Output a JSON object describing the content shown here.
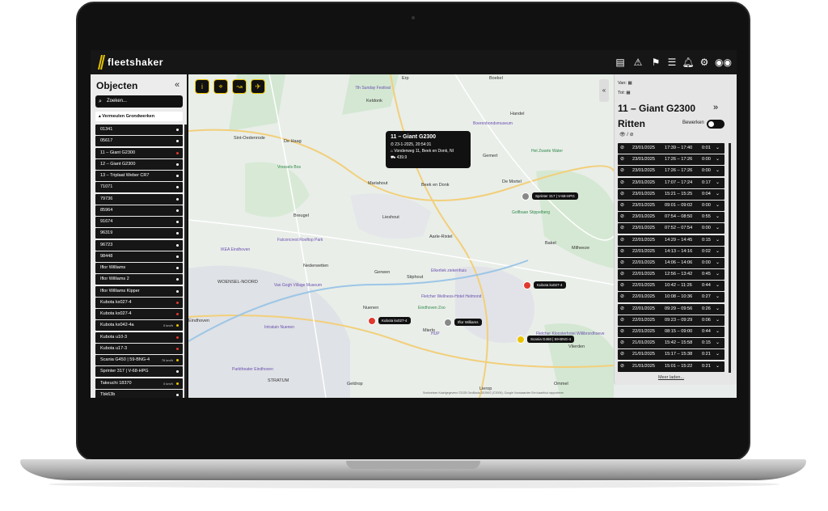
{
  "app": {
    "brand": "fleetshaker"
  },
  "topbar": {
    "icons": [
      "overview-icon",
      "alarm-icon",
      "route-icon",
      "report-icon",
      "bell-icon",
      "settings-icon",
      "vr-icon"
    ]
  },
  "objects_panel": {
    "title": "Objecten",
    "collapse": "«",
    "search_placeholder": "Zoeken...",
    "group": "Vermeulen Grondwerken",
    "items": [
      {
        "label": "01341",
        "dot": "#ffffff",
        "speed": ""
      },
      {
        "label": "05617",
        "dot": "#ffffff",
        "speed": ""
      },
      {
        "label": "11 – Giant G2300",
        "dot": "#e0392e",
        "speed": ""
      },
      {
        "label": "12 – Giant G2300",
        "dot": "#ffffff",
        "speed": ""
      },
      {
        "label": "13 – Triplaat Weber CR7",
        "dot": "#ffffff",
        "speed": ""
      },
      {
        "label": "71071",
        "dot": "#ffffff",
        "speed": ""
      },
      {
        "label": "79736",
        "dot": "#ffffff",
        "speed": ""
      },
      {
        "label": "85964",
        "dot": "#ffffff",
        "speed": ""
      },
      {
        "label": "91674",
        "dot": "#ffffff",
        "speed": ""
      },
      {
        "label": "96319",
        "dot": "#ffffff",
        "speed": ""
      },
      {
        "label": "96723",
        "dot": "#ffffff",
        "speed": ""
      },
      {
        "label": "98448",
        "dot": "#ffffff",
        "speed": ""
      },
      {
        "label": "Iflor Williams",
        "dot": "#ffffff",
        "speed": ""
      },
      {
        "label": "Iflor Williams 2",
        "dot": "#ffffff",
        "speed": ""
      },
      {
        "label": "Iflor Williams Kipper",
        "dot": "#ffffff",
        "speed": ""
      },
      {
        "label": "Kubota kx027-4",
        "dot": "#e0392e",
        "speed": ""
      },
      {
        "label": "Kubota kx027-4",
        "dot": "#e0392e",
        "speed": ""
      },
      {
        "label": "Kubota kx042-4a",
        "dot": "#e8c400",
        "speed": "0 km/h"
      },
      {
        "label": "Kubota u10-3",
        "dot": "#e0392e",
        "speed": ""
      },
      {
        "label": "Kubota u17-3",
        "dot": "#e0392e",
        "speed": ""
      },
      {
        "label": "Scania G450 | 59-BNG-4",
        "dot": "#e8c400",
        "speed": "76 km/h"
      },
      {
        "label": "Sprinter 317 | V-68-HPG",
        "dot": "#ffffff",
        "speed": ""
      },
      {
        "label": "Takeuchi 18370",
        "dot": "#e8c400",
        "speed": "0 km/h"
      },
      {
        "label": "Tbk63b",
        "dot": "#ffffff",
        "speed": ""
      }
    ]
  },
  "map": {
    "tools": [
      "i",
      "⌖",
      "↝",
      "✈"
    ],
    "places": [
      {
        "t": "Erp",
        "c": "label"
      },
      {
        "t": "Boekel",
        "c": "label"
      },
      {
        "t": "Keldonk",
        "c": "label"
      },
      {
        "t": "Sint-Oedenrode",
        "c": "label"
      },
      {
        "t": "De Haag",
        "c": "label"
      },
      {
        "t": "Handel",
        "c": "label"
      },
      {
        "t": "Gemert",
        "c": "label"
      },
      {
        "t": "Mariahout",
        "c": "label"
      },
      {
        "t": "Beek en Donk",
        "c": "label"
      },
      {
        "t": "De Mortel",
        "c": "label"
      },
      {
        "t": "Breugel",
        "c": "label"
      },
      {
        "t": "Lieshout",
        "c": "label"
      },
      {
        "t": "Aarle-Rixtel",
        "c": "label"
      },
      {
        "t": "Bakel",
        "c": "label"
      },
      {
        "t": "Milheeze",
        "c": "label"
      },
      {
        "t": "Nederwetten",
        "c": "label"
      },
      {
        "t": "Gerwen",
        "c": "label"
      },
      {
        "t": "Stiphout",
        "c": "label"
      },
      {
        "t": "WOENSEL-NOORD",
        "c": "label"
      },
      {
        "t": "Nuenen",
        "c": "label"
      },
      {
        "t": "Eindhoven",
        "c": "label"
      },
      {
        "t": "Mierlo",
        "c": "label"
      },
      {
        "t": "Vlierden",
        "c": "label"
      },
      {
        "t": "STRATUM",
        "c": "label"
      },
      {
        "t": "Geldrop",
        "c": "label"
      },
      {
        "t": "Lierop",
        "c": "label"
      },
      {
        "t": "Ommel",
        "c": "label"
      },
      {
        "t": "7th Sunday Festival",
        "c": "poi"
      },
      {
        "t": "Boerenbondsmuseum",
        "c": "poi"
      },
      {
        "t": "Het Zwarte Water",
        "c": "poi poi-g"
      },
      {
        "t": "Vressels Bos",
        "c": "poi poi-g"
      },
      {
        "t": "Golfbaan Stippelberg",
        "c": "poi poi-g"
      },
      {
        "t": "Falconcrest Rooftop Park",
        "c": "poi"
      },
      {
        "t": "IKEA Eindhoven",
        "c": "poi"
      },
      {
        "t": "Van Gogh Village Museum",
        "c": "poi"
      },
      {
        "t": "Elkerliek ziekenhuis",
        "c": "poi"
      },
      {
        "t": "Fletcher Wellness-Hotel Helmond",
        "c": "poi"
      },
      {
        "t": "Eindhoven Zoo",
        "c": "poi poi-g"
      },
      {
        "t": "HUP",
        "c": "poi"
      },
      {
        "t": "Fletcher Kloosterhotel Willibrordhoeve",
        "c": "poi"
      },
      {
        "t": "Parktheater Eindhoven",
        "c": "poi"
      },
      {
        "t": "Intratuin Nuenen",
        "c": "poi"
      }
    ],
    "vehicles": [
      {
        "label": "Kubota kx027-4",
        "color": "#e0392e"
      },
      {
        "label": "Kubota kx027-4",
        "color": "#e0392e"
      },
      {
        "label": "Iflor Williams",
        "color": "#888888"
      },
      {
        "label": "Scania G450 | 59-BNG-4",
        "color": "#e8c400"
      },
      {
        "label": "Sprinter 317 | V-68-HPG",
        "color": "#888888"
      }
    ],
    "popup": {
      "title": "11 – Giant G2300",
      "time": "23-1-2025, 20:54:31",
      "address": "Vonderweg 11, Beek en Donk, NI",
      "odo": "439.9"
    },
    "attribution": "Sneltoetsen   Kaartgegevens ©2025 GeoBasis-DE/BKG (©2009), Google   Voorwaarden   Een kaartfout rapporteren"
  },
  "rides_panel": {
    "van": "Van:",
    "tot": "Tot:",
    "vehicle": "11 – Giant G2300",
    "next": "»",
    "title": "Ritten",
    "bewerken": "Bewerken",
    "eye_filter": "👁 / ⊘",
    "more": "Meer laden...",
    "trips": [
      {
        "date": "23/01/2025",
        "time": "17:39 – 17:40",
        "dur": "0:01"
      },
      {
        "date": "23/01/2025",
        "time": "17:26 – 17:26",
        "dur": "0:00"
      },
      {
        "date": "23/01/2025",
        "time": "17:26 – 17:26",
        "dur": "0:00"
      },
      {
        "date": "23/01/2025",
        "time": "17:07 – 17:24",
        "dur": "0:17"
      },
      {
        "date": "23/01/2025",
        "time": "15:21 – 15:25",
        "dur": "0:04"
      },
      {
        "date": "23/01/2025",
        "time": "09:01 – 09:02",
        "dur": "0:00"
      },
      {
        "date": "23/01/2025",
        "time": "07:54 – 08:50",
        "dur": "0:55"
      },
      {
        "date": "23/01/2025",
        "time": "07:52 – 07:54",
        "dur": "0:00"
      },
      {
        "date": "22/01/2025",
        "time": "14:29 – 14:45",
        "dur": "0:15"
      },
      {
        "date": "22/01/2025",
        "time": "14:13 – 14:16",
        "dur": "0:02"
      },
      {
        "date": "22/01/2025",
        "time": "14:06 – 14:06",
        "dur": "0:00"
      },
      {
        "date": "22/01/2025",
        "time": "12:56 – 13:42",
        "dur": "0:45"
      },
      {
        "date": "22/01/2025",
        "time": "10:42 – 11:26",
        "dur": "0:44"
      },
      {
        "date": "22/01/2025",
        "time": "10:08 – 10:36",
        "dur": "0:27"
      },
      {
        "date": "22/01/2025",
        "time": "09:29 – 09:56",
        "dur": "0:26"
      },
      {
        "date": "22/01/2025",
        "time": "09:23 – 09:29",
        "dur": "0:06"
      },
      {
        "date": "22/01/2025",
        "time": "08:15 – 09:00",
        "dur": "0:44"
      },
      {
        "date": "21/01/2025",
        "time": "15:42 – 15:58",
        "dur": "0:15"
      },
      {
        "date": "21/01/2025",
        "time": "15:17 – 15:38",
        "dur": "0:21"
      },
      {
        "date": "21/01/2025",
        "time": "15:01 – 15:22",
        "dur": "0:21"
      }
    ]
  },
  "colors": {
    "accent": "#e8c400",
    "alert": "#e0392e",
    "panel": "#161616"
  }
}
